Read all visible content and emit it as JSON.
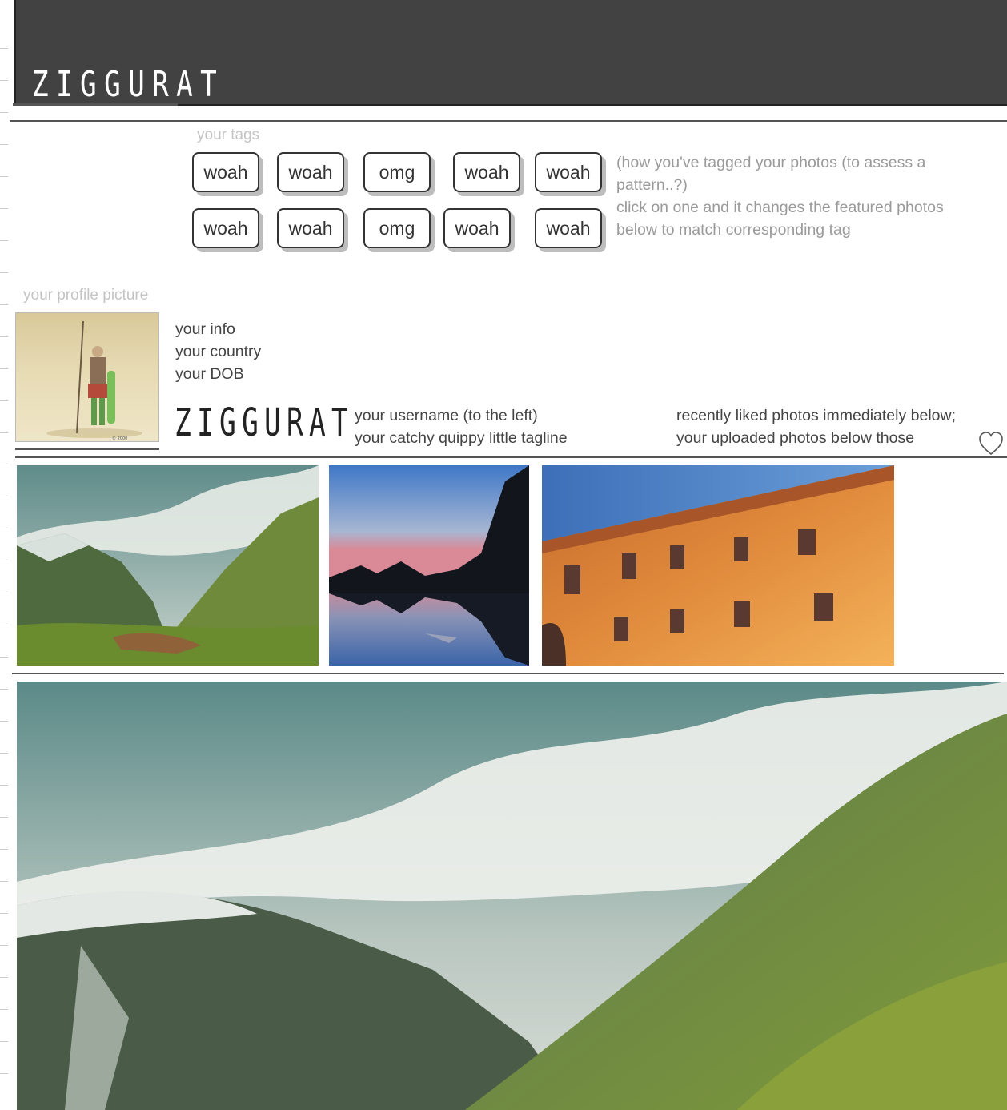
{
  "header": {
    "logo": "ZIGGURAT"
  },
  "tags": {
    "label": "your tags",
    "row1": [
      "woah",
      "woah",
      "omg",
      "woah",
      "woah"
    ],
    "row2": [
      "woah",
      "woah",
      "omg",
      "woah",
      "woah"
    ],
    "note": "(how you've tagged your photos (to assess a pattern..?)\nclick on one and it changes the featured photos below to match corresponding tag"
  },
  "profile": {
    "picture_label": "your profile picture",
    "info": [
      "your info",
      "your country",
      "your DOB"
    ],
    "username_logo": "ZIGGURAT",
    "username_lines": [
      "your username (to the left)",
      "your catchy quippy little tagline"
    ],
    "liked_lines": [
      "recently liked photos immediately below;",
      "your uploaded photos below those"
    ]
  },
  "icons": {
    "heart": "heart-icon"
  }
}
